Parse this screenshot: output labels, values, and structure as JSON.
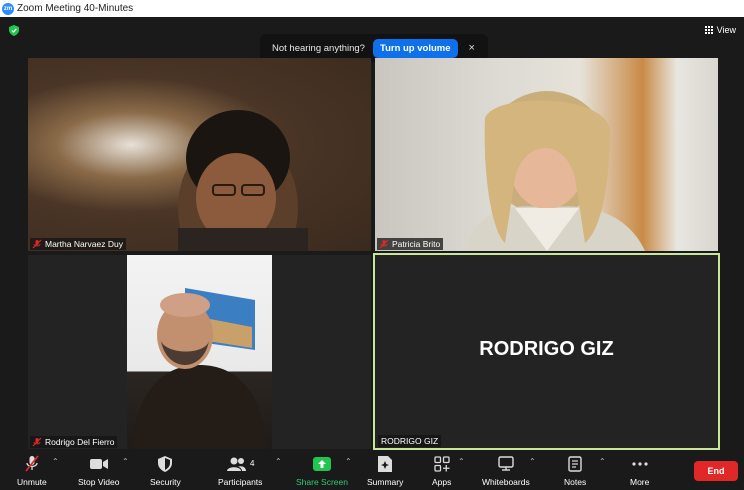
{
  "window": {
    "title": "Zoom Meeting 40-Minutes",
    "logo_text": "zm"
  },
  "header": {
    "view_label": "View"
  },
  "toast": {
    "message": "Not hearing anything?",
    "action_label": "Turn up volume",
    "close_glyph": "×"
  },
  "participants": [
    {
      "name": "Martha Narvaez Duy",
      "muted": true
    },
    {
      "name": "Patricia Brito",
      "muted": true
    },
    {
      "name": "Rodrigo Del Fierro",
      "muted": true
    },
    {
      "name": "RODRIGO GIZ",
      "display_text": "RODRIGO GIZ",
      "active_speaker": true
    }
  ],
  "toolbar": {
    "unmute": "Unmute",
    "stop_video": "Stop Video",
    "security": "Security",
    "participants": "Participants",
    "participants_count": "4",
    "share_screen": "Share Screen",
    "summary": "Summary",
    "apps": "Apps",
    "whiteboards": "Whiteboards",
    "notes": "Notes",
    "more": "More",
    "end": "End"
  },
  "colors": {
    "accent": "#0e71eb",
    "end": "#e02828",
    "share": "#2ecc71",
    "active_border": "#c8e697"
  },
  "icons": [
    "shield-icon",
    "grid-icon",
    "mic-off-icon",
    "video-icon",
    "security-icon",
    "participants-icon",
    "share-screen-icon",
    "summary-icon",
    "apps-icon",
    "whiteboard-icon",
    "notes-icon",
    "more-icon"
  ]
}
